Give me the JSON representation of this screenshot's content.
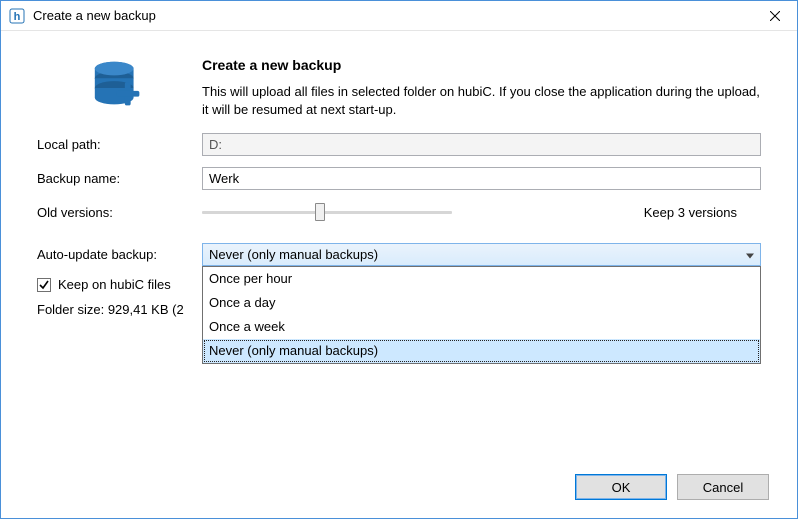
{
  "titlebar": {
    "title": "Create a new backup"
  },
  "header": {
    "title": "Create a new backup",
    "description": "This will upload all files in selected folder on hubiC. If you close the application during the upload, it will be resumed at next start-up."
  },
  "labels": {
    "local_path": "Local path:",
    "backup_name": "Backup name:",
    "old_versions": "Old versions:",
    "auto_update": "Auto-update backup:"
  },
  "fields": {
    "local_path": "D:",
    "backup_name": "Werk",
    "versions_text": "Keep 3 versions"
  },
  "auto_update": {
    "selected": "Never (only manual backups)",
    "options": [
      "Once per hour",
      "Once a day",
      "Once a week",
      "Never (only manual backups)"
    ]
  },
  "checkbox": {
    "label": "Keep on hubiC files",
    "checked": true
  },
  "folder_size_prefix": "Folder size: ",
  "folder_size_value": "929,41 KB (2",
  "buttons": {
    "ok": "OK",
    "cancel": "Cancel"
  },
  "colors": {
    "accent": "#2573b5"
  }
}
